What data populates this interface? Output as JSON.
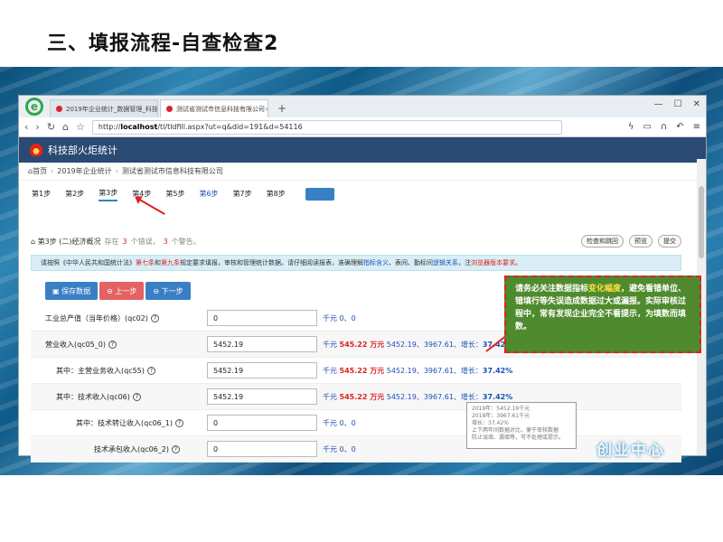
{
  "slide": {
    "title": "三、填报流程-自查检查2"
  },
  "browser": {
    "tabs": [
      {
        "label": "2019年企业统计_数据管理_科技"
      },
      {
        "label": "测试省测试市信息科技有限公司"
      }
    ],
    "new_tab": "+",
    "url_prefix": "http://",
    "url_host": "localhost",
    "url_path": "/tl/tldfill.aspx?ut=q&did=191&d=54116"
  },
  "app": {
    "title": "科技部火炬统计",
    "breadcrumb": [
      "首页",
      "2019年企业统计",
      "测试省测试市信息科技有限公司"
    ],
    "steps": [
      "第1步",
      "第2步",
      "第3步",
      "第4步",
      "第5步",
      "第6步",
      "第7步",
      "第8步"
    ],
    "current_step": 2
  },
  "section": {
    "title": "第3步 (二)经济概况",
    "warning_prefix": "存在",
    "warning_count_1": "3",
    "warning_mid": "个错误，",
    "warning_count_2": "3",
    "warning_suffix": "个警告。",
    "buttons": {
      "check": "检查和跳回",
      "preview": "预览",
      "submit": "提交"
    }
  },
  "notice": {
    "text1": "请按照《中华人民共和国统计法》",
    "law1": "第七条",
    "text2": "和",
    "law2": "第九条",
    "text3": "规定要求填报，审核和管理统计数据。请仔细阅读报表，准确理解",
    "link1": "指标含义",
    "text4": "、表间、勤标间",
    "link2": "逻辑关系",
    "text5": "，注",
    "link3": "浏览器版本要求",
    "text6": "。"
  },
  "actions": {
    "save": "保存数据",
    "prev": "上一步",
    "next": "下一步"
  },
  "rows": [
    {
      "label": "工业总产值（当年价格）(qc02)",
      "value": "0",
      "unit": "千元",
      "sep": "0、0"
    },
    {
      "label": "营业收入(qc05_0)",
      "value": "5452.19",
      "unit": "千元",
      "highlight": "545.22 万元",
      "prev": "5452.19、3967.61、增长：",
      "pct": "37.42%"
    },
    {
      "label": "其中：主营业务收入(qc55)",
      "value": "5452.19",
      "unit": "千元",
      "highlight": "545.22 万元",
      "prev": "5452.19、3967.61、增长：",
      "pct": "37.42%"
    },
    {
      "label": "其中：技术收入(qc06)",
      "value": "5452.19",
      "unit": "千元",
      "highlight": "545.22 万元",
      "prev": "5452.19、3967.61、增长：",
      "pct": "37.42%"
    },
    {
      "label": "其中：技术转让收入(qc06_1)",
      "value": "0",
      "unit": "千元",
      "sep": "0、0"
    },
    {
      "label": "技术承包收入(qc06_2)",
      "value": "0",
      "unit": "千元",
      "sep": "0、0"
    }
  ],
  "callout": {
    "text_a": "请务必关注数据指标",
    "highlight": "变化幅度",
    "text_b": "，避免看错单位、错填行等失误造成数据过大或漏报。实际审核过程中，常有发现企业完全不看提示，为填数而填数。"
  },
  "tooltip": {
    "line1": "2019年：5452.19千元",
    "line2": "2018年：3967.61千元",
    "line3": "增长：37.42%",
    "line4": "上下两年间数据对比，便于审核数据",
    "line5": "防止误填、漏填等，可不处理或提示。"
  },
  "watermark": "创业中心",
  "colors": {
    "header": "#2b4a73",
    "callout_bg": "#4f8a2e",
    "accent_red": "#d22",
    "link_blue": "#1e50b4"
  }
}
